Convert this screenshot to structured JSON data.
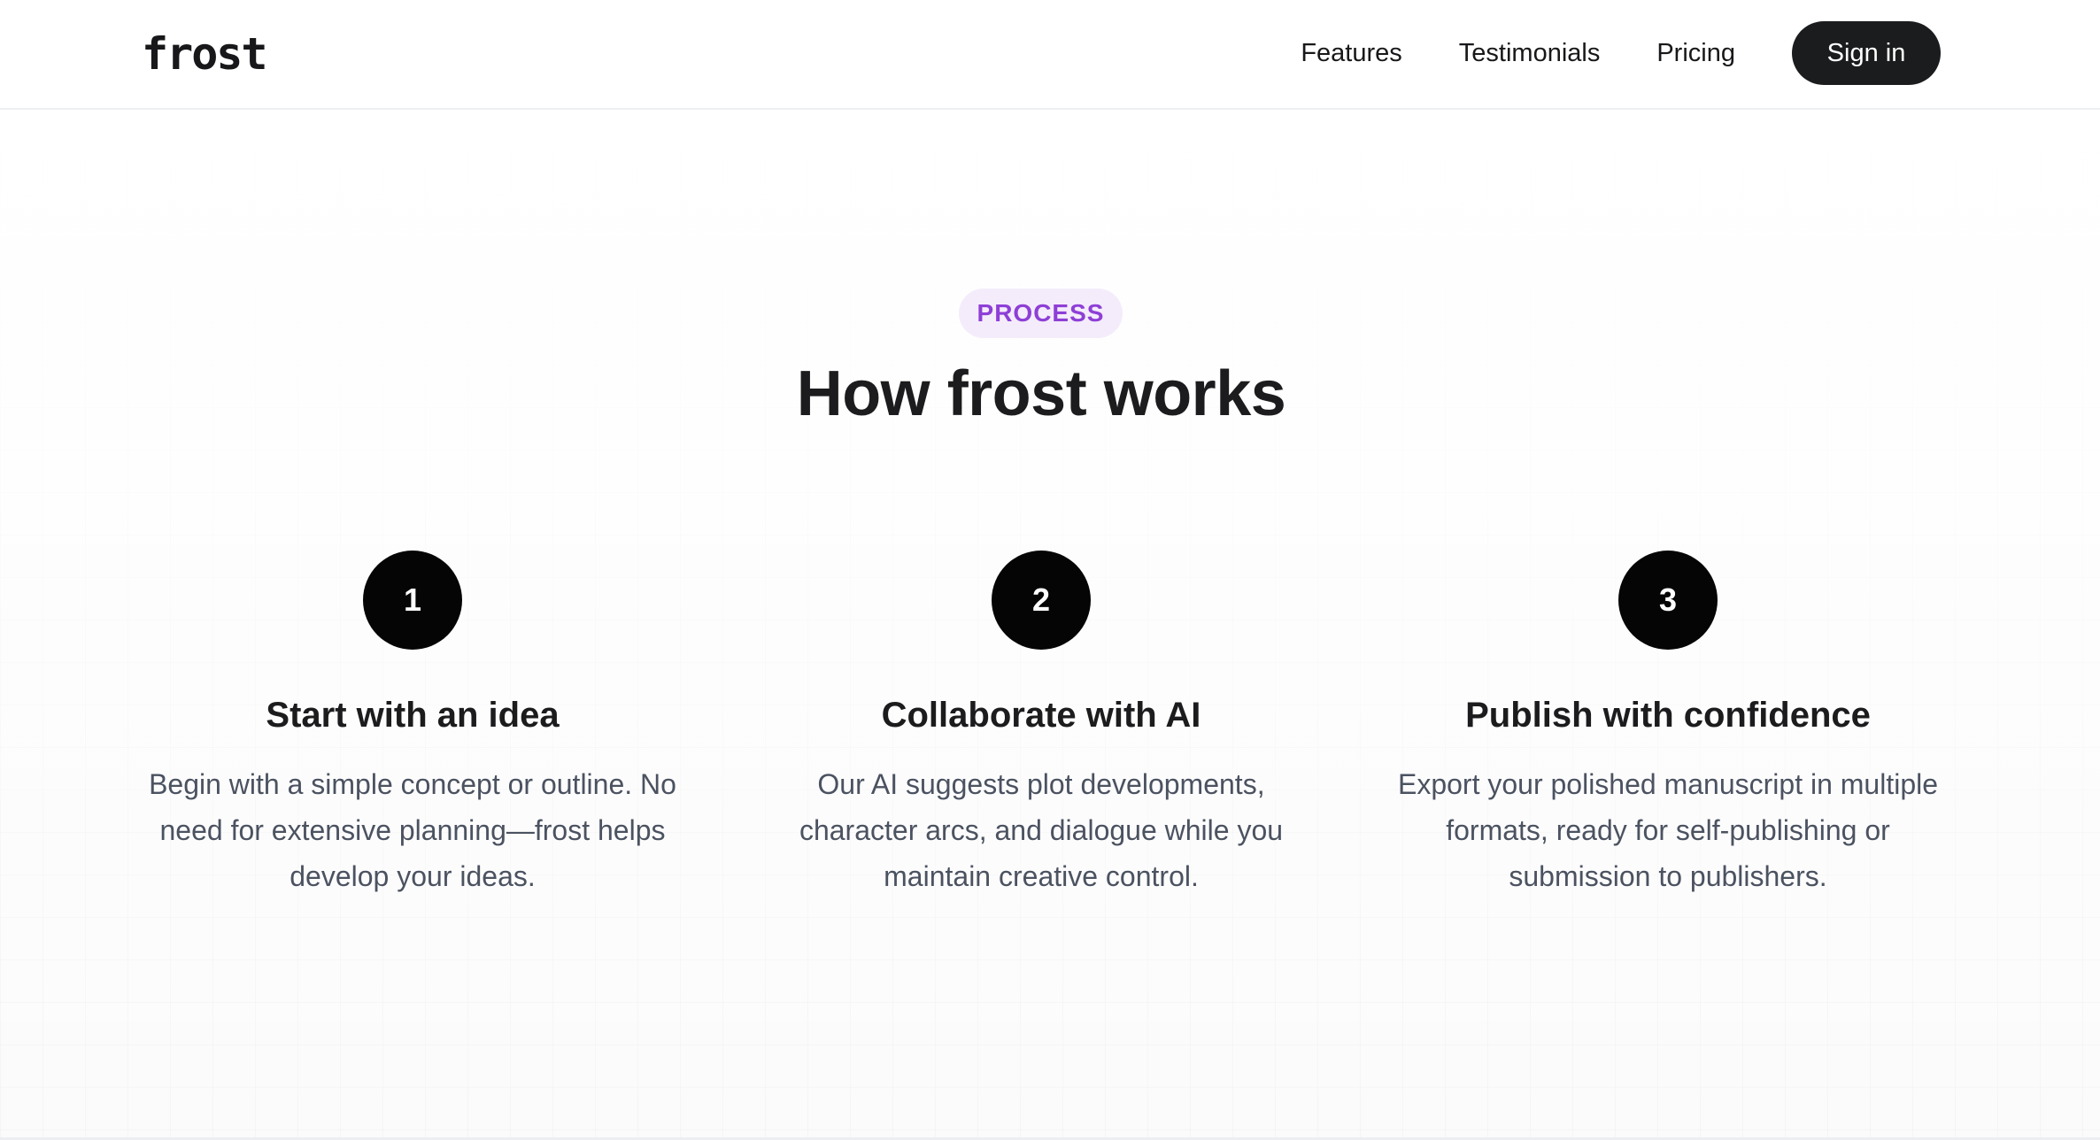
{
  "header": {
    "logo": "frost",
    "nav": [
      {
        "label": "Features"
      },
      {
        "label": "Testimonials"
      },
      {
        "label": "Pricing"
      }
    ],
    "signin_label": "Sign in"
  },
  "section": {
    "badge": "PROCESS",
    "title": "How frost works",
    "steps": [
      {
        "number": "1",
        "title": "Start with an idea",
        "description": "Begin with a simple concept or outline. No need for extensive planning—frost helps develop your ideas."
      },
      {
        "number": "2",
        "title": "Collaborate with AI",
        "description": "Our AI suggests plot developments, character arcs, and dialogue while you maintain creative control."
      },
      {
        "number": "3",
        "title": "Publish with confidence",
        "description": "Export your polished manuscript in multiple formats, ready for self-publishing or submission to publishers."
      }
    ]
  },
  "colors": {
    "accent": "#8e3fd6",
    "badge_bg": "#f4ecfb",
    "primary_button": "#1b1c1e",
    "step_circle": "#050505",
    "body_text": "#4b5260"
  }
}
